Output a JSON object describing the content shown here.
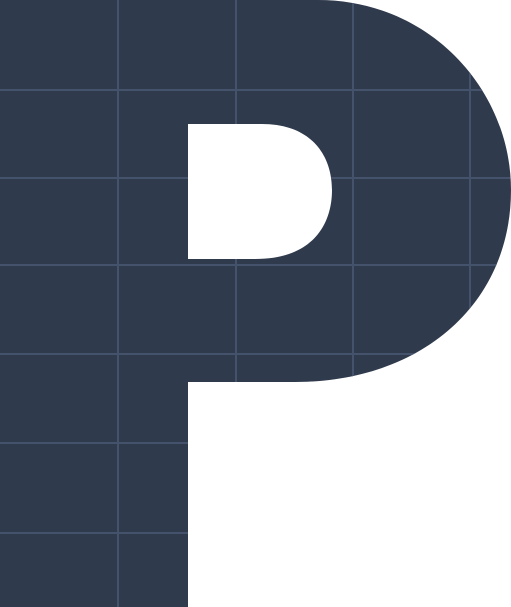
{
  "logo": {
    "glyph": "P",
    "description_color": "#2f3a4c",
    "grid_color": "#44536b",
    "background_color": "#ffffff"
  }
}
